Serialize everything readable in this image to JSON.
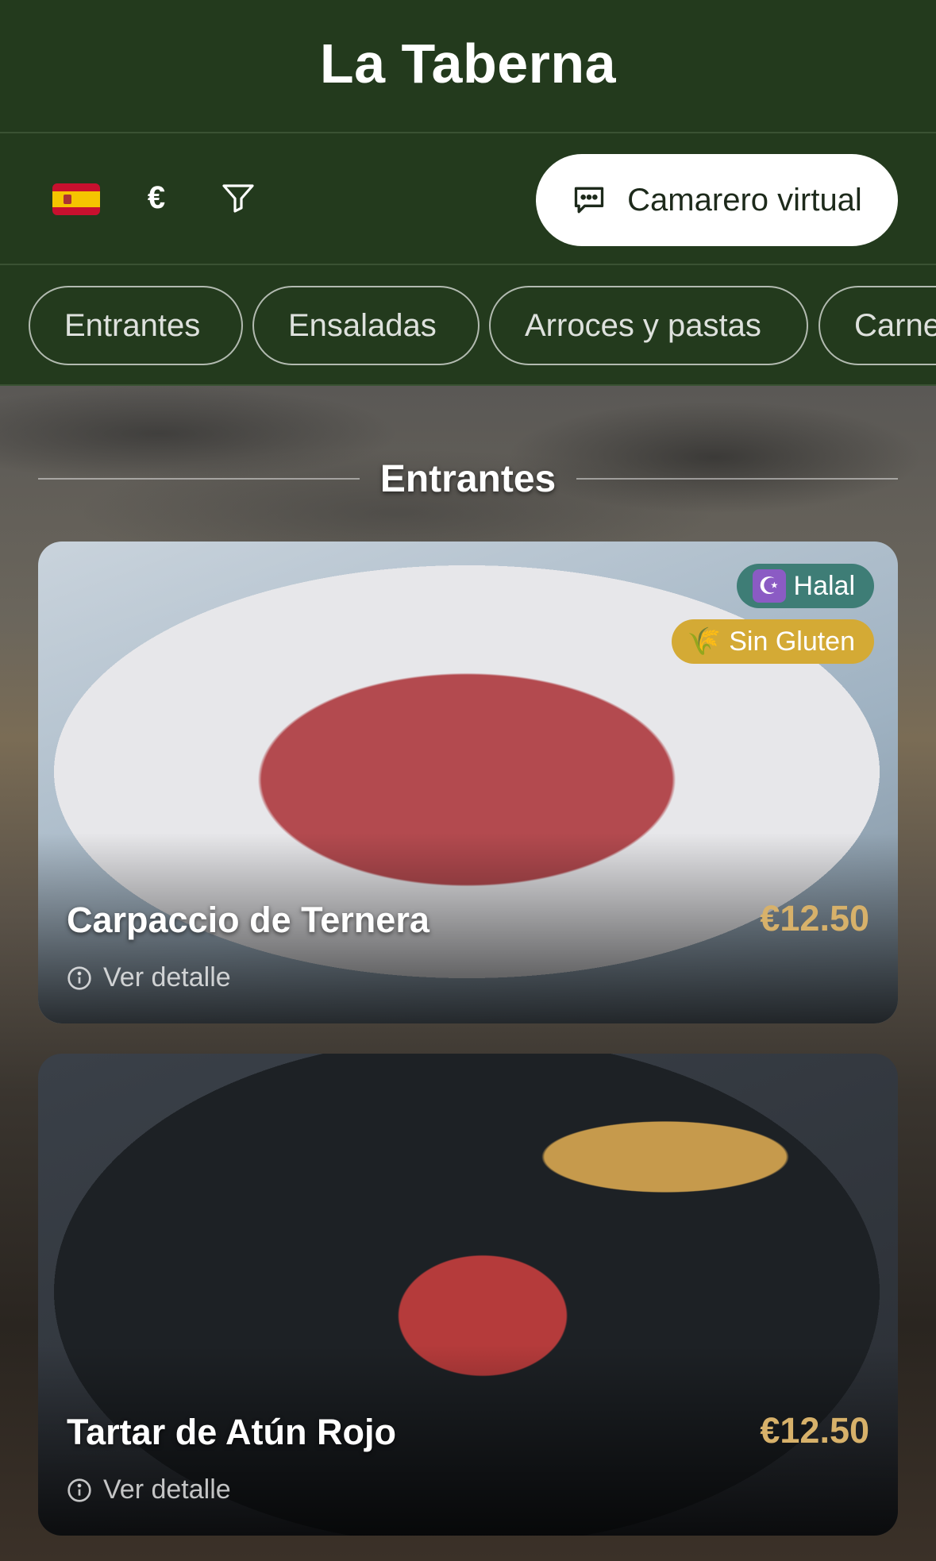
{
  "header": {
    "title": "La Taberna"
  },
  "toolbar": {
    "language_flag": "spain-flag-icon",
    "currency_symbol": "€",
    "filter_icon": "filter-icon",
    "waiter_button_label": "Camarero virtual",
    "waiter_icon": "chat-bubble-icon"
  },
  "categories": [
    "Entrantes",
    "Ensaladas",
    "Arroces y pastas",
    "Carne"
  ],
  "section": {
    "title": "Entrantes"
  },
  "dishes": [
    {
      "name": "Carpaccio de Ternera",
      "price": "€12.50",
      "detail_label": "Ver detalle",
      "badges": [
        {
          "icon": "☪",
          "label": "Halal",
          "color": "#3e7d76"
        },
        {
          "icon": "🌾",
          "label": "Sin Gluten",
          "color": "#d4aa35"
        }
      ]
    },
    {
      "name": "Tartar de Atún Rojo",
      "price": "€12.50",
      "detail_label": "Ver detalle",
      "badges": []
    }
  ],
  "colors": {
    "header_bg": "#233a1d",
    "price": "#d7b16a",
    "halal_badge": "#3e7d76",
    "gluten_free_badge": "#d4aa35"
  }
}
